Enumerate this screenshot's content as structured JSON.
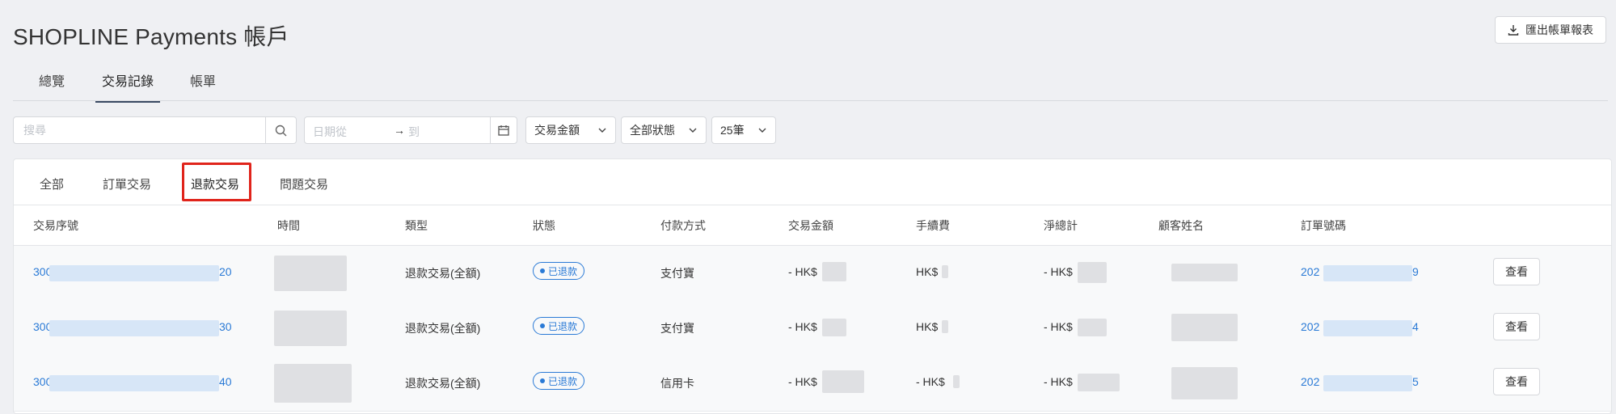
{
  "header": {
    "title": "SHOPLINE Payments 帳戶",
    "export_label": "匯出帳單報表",
    "export_icon": "download-icon"
  },
  "top_tabs": [
    "總覽",
    "交易記錄",
    "帳單"
  ],
  "filters": {
    "search_placeholder": "搜尋",
    "date_from": "日期從",
    "date_arrow": "→",
    "date_to": "到",
    "amount_select": "交易金額",
    "status_select": "全部狀態",
    "page_size_select": "25筆"
  },
  "sub_tabs": [
    "全部",
    "訂單交易",
    "退款交易",
    "問題交易"
  ],
  "table": {
    "headers": [
      "交易序號",
      "時間",
      "類型",
      "狀態",
      "付款方式",
      "交易金額",
      "手續費",
      "淨總計",
      "顧客姓名",
      "訂單號碼"
    ],
    "rows": [
      {
        "id_start": "300",
        "id_end": "20",
        "type": "退款交易(全額)",
        "status": "已退款",
        "method": "支付寶",
        "amount": "- HK$",
        "fee": "HK$",
        "net": "- HK$",
        "order_start": "202",
        "order_end": "9",
        "action": "查看"
      },
      {
        "id_start": "300",
        "id_end": "30",
        "type": "退款交易(全額)",
        "status": "已退款",
        "method": "支付寶",
        "amount": "- HK$",
        "fee": "HK$",
        "net": "- HK$",
        "order_start": "202",
        "order_end": "4",
        "action": "查看"
      },
      {
        "id_start": "300",
        "id_end": "40",
        "type": "退款交易(全額)",
        "status": "已退款",
        "method": "信用卡",
        "amount": "- HK$",
        "fee": "- HK$",
        "net": "- HK$",
        "order_start": "202",
        "order_end": "5",
        "action": "查看"
      }
    ]
  },
  "colors": {
    "accent": "#2a7ad6",
    "highlight": "#e0241b",
    "background": "#eff0f3"
  }
}
